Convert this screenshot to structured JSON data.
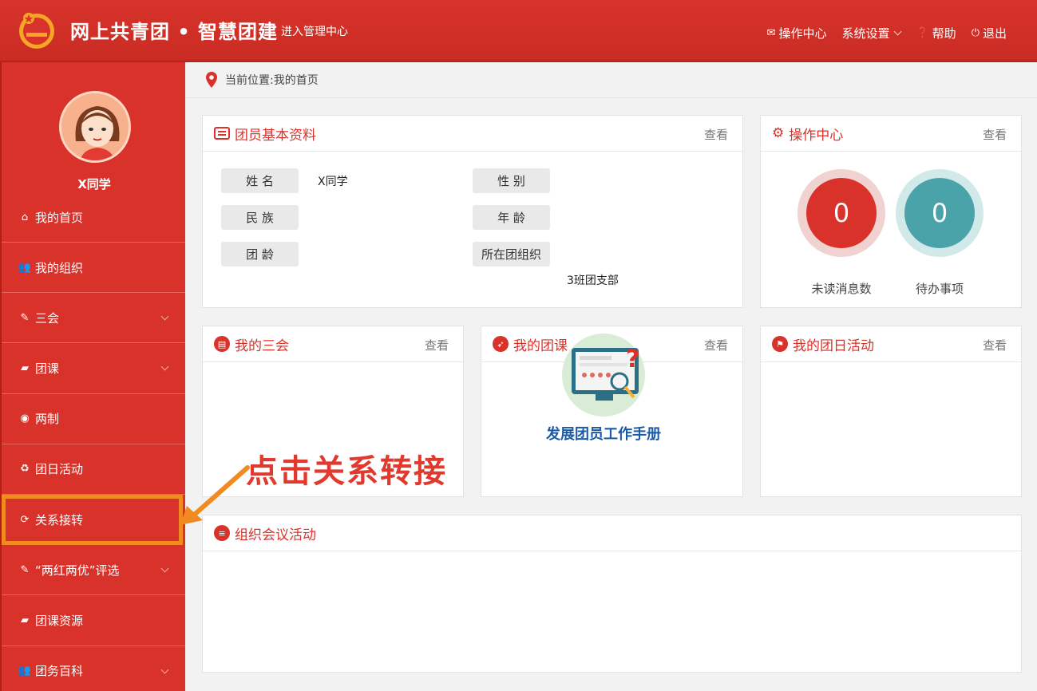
{
  "header": {
    "brand": "网上共青团 • 智慧团建",
    "admin_link": "进入管理中心",
    "nav": [
      {
        "icon": "mail-icon",
        "label": "操作中心"
      },
      {
        "icon": "",
        "label": "系统设置"
      },
      {
        "icon": "help-icon",
        "label": "帮助"
      },
      {
        "icon": "power-icon",
        "label": "退出"
      }
    ]
  },
  "sidebar": {
    "username": "X同学",
    "items": [
      {
        "label": "我的首页",
        "icon": "home-icon",
        "expandable": false
      },
      {
        "label": "我的组织",
        "icon": "users-icon",
        "expandable": false
      },
      {
        "label": "三会",
        "icon": "edit-icon",
        "expandable": true
      },
      {
        "label": "团课",
        "icon": "folder-open-icon",
        "expandable": true
      },
      {
        "label": "两制",
        "icon": "dot-circle-icon",
        "expandable": false
      },
      {
        "label": "团日活动",
        "icon": "recycle-icon",
        "expandable": false
      },
      {
        "label": "关系接转",
        "icon": "refresh-icon",
        "expandable": false
      },
      {
        "label": "“两红两优”评选",
        "icon": "edit-icon",
        "expandable": true
      },
      {
        "label": "团课资源",
        "icon": "folder-open-icon",
        "expandable": false
      },
      {
        "label": "团务百科",
        "icon": "users-icon",
        "expandable": true
      }
    ]
  },
  "breadcrumb": {
    "text": "当前位置:我的首页"
  },
  "profile": {
    "title": "团员基本资料",
    "more": "查看",
    "fields": {
      "name_label": "姓 名",
      "name_value": "X同学",
      "gender_label": "性 别",
      "ethnicity_label": "民 族",
      "age_label": "年 龄",
      "league_age_label": "团 龄",
      "org_label": "所在团组织",
      "org_value": "3班团支部"
    }
  },
  "ops": {
    "title": "操作中心",
    "more": "查看",
    "unread_value": "0",
    "unread_label": "未读消息数",
    "todo_value": "0",
    "todo_label": "待办事项",
    "colors": {
      "red": "#d9322a",
      "teal": "#4aa3a8"
    }
  },
  "three_meetings": {
    "title": "我的三会",
    "more": "查看"
  },
  "league_class": {
    "title": "我的团课",
    "more": "查看"
  },
  "league_day": {
    "title": "我的团日活动",
    "more": "查看"
  },
  "meetings": {
    "title": "组织会议活动"
  },
  "annotation": {
    "text": "点击关系转接",
    "color": "#e0392d",
    "arrow_color": "#f28a22"
  },
  "handbook": {
    "caption": "发展团员工作手册"
  }
}
